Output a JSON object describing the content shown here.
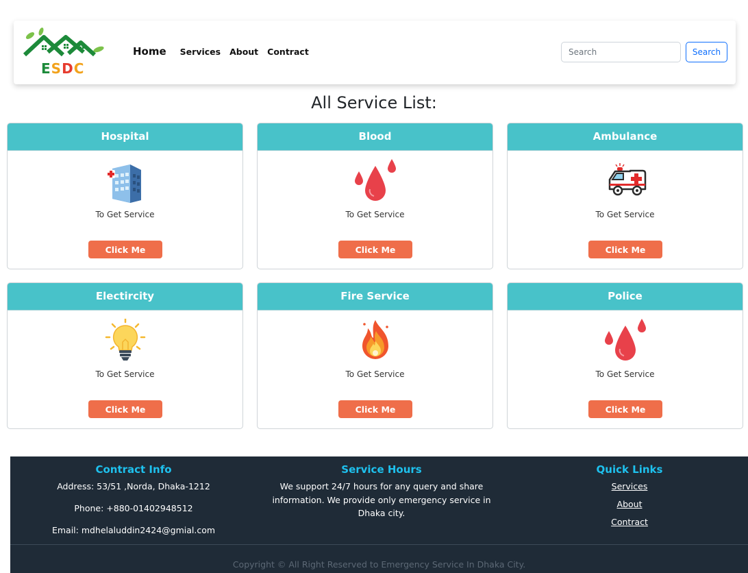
{
  "navbar": {
    "logo_text": "ESDC",
    "home": "Home",
    "links": [
      "Services",
      "About",
      "Contract"
    ],
    "search_placeholder": "Search",
    "search_button": "Search"
  },
  "page_title": "All Service List:",
  "services": [
    {
      "title": "Hospital",
      "text": "To Get Service",
      "button": "Click Me",
      "icon": "hospital-building-icon"
    },
    {
      "title": "Blood",
      "text": "To Get Service",
      "button": "Click Me",
      "icon": "blood-drops-icon"
    },
    {
      "title": "Ambulance",
      "text": "To Get Service",
      "button": "Click Me",
      "icon": "ambulance-icon"
    },
    {
      "title": "Electircity",
      "text": "To Get Service",
      "button": "Click Me",
      "icon": "light-bulb-icon"
    },
    {
      "title": "Fire Service",
      "text": "To Get Service",
      "button": "Click Me",
      "icon": "fire-icon"
    },
    {
      "title": "Police",
      "text": "To Get Service",
      "button": "Click Me",
      "icon": "blood-drops-icon"
    }
  ],
  "footer": {
    "contact": {
      "title": "Contract Info",
      "address": "Address: 53/51 ,Norda, Dhaka-1212",
      "phone": "Phone: +880-01402948512",
      "email": "Email: mdhelaluddin2424@gmial.com"
    },
    "hours": {
      "title": "Service Hours",
      "line1": "We support 24/7 hours for any query and share",
      "line2": "information. We provide only emergency service in",
      "line3": "Dhaka city."
    },
    "quick_links": {
      "title": "Quick Links",
      "links": [
        "Services",
        "About",
        "Contract"
      ]
    },
    "copyright": "Copyright © All Right Reserved to Emergency Service In Dhaka City."
  },
  "colors": {
    "card_header": "#48c2c9",
    "button": "#ef6e4a",
    "footer_bg": "#1f2b37",
    "footer_title": "#1ec1ee",
    "primary": "#0d6efd"
  }
}
